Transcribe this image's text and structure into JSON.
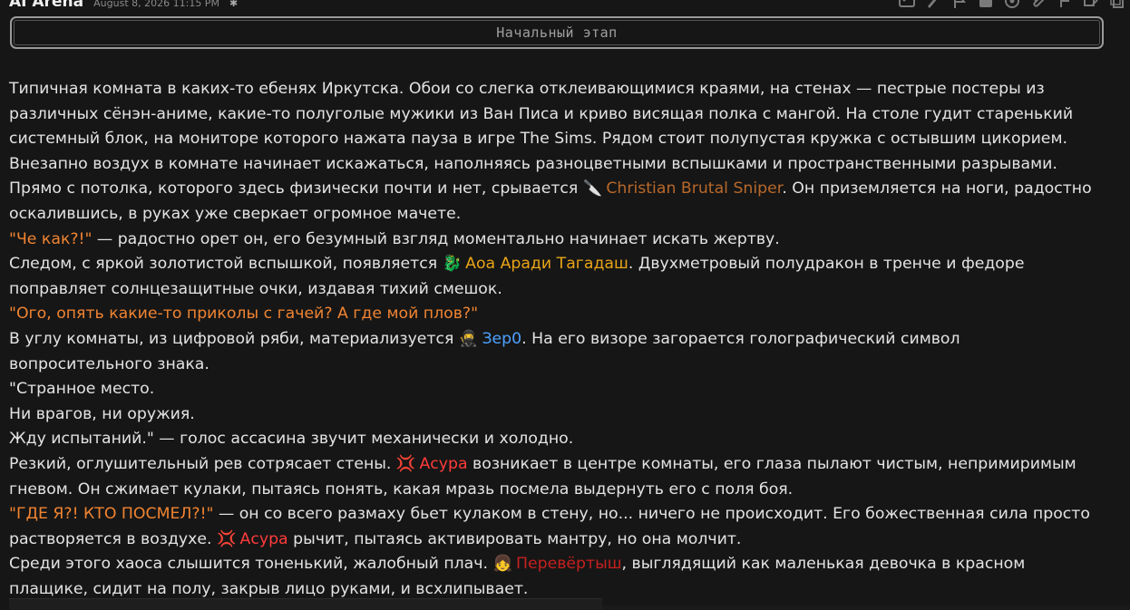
{
  "header": {
    "author": "AI Arena",
    "timestamp": "August 8, 2026 11:15 PM",
    "mark": "✱"
  },
  "toolbar": {
    "icons": [
      "image-icon",
      "brush-icon",
      "flag-icon",
      "card-icon",
      "globe-icon",
      "paperclip-icon",
      "branch-icon",
      "edit-icon",
      "copy-icon"
    ]
  },
  "stage": {
    "title": "Начальный этап"
  },
  "colors": {
    "background": "#161616",
    "text": "#e3e3e3",
    "quote": "#f08432",
    "sniper": "#b8682a",
    "aoa": "#e8a417",
    "zero": "#4ea1ff",
    "asura": "#ff3b3b",
    "perevertysh": "#c62020"
  },
  "story": {
    "l1": "Типичная комната в каких-то ебенях Иркутска. Обои со слегка отклеивающимися краями, на стенах — пестрые постеры из",
    "l2": "различных сёнэн-аниме, какие-то полуголые мужики из Ван Писа и криво висящая полка с мангой. На столе гудит старенький",
    "l3": "системный блок, на мониторе которого нажата пауза в игре The Sims. Рядом стоит полупустая кружка с остывшим цикорием.",
    "l4": "Внезапно воздух в комнате начинает искажаться, наполняясь разноцветными вспышками и пространственными разрывами.",
    "l5a": "Прямо с потолка, которого здесь физически почти и нет, срывается ",
    "l5_emoji": "🔪",
    "l5_name": "Christian Brutal Sniper",
    "l5b": ". Он приземляется на ноги, радостно",
    "l6": "оскалившись, в руках уже сверкает огромное мачете.",
    "l7_quote": "\"Че как?!\"",
    "l7b": " — радостно орет он, его безумный взгляд моментально начинает искать жертву.",
    "l8a": "Следом, с яркой золотистой вспышкой, появляется ",
    "l8_emoji": "🐉",
    "l8_name": "Аоа Аради Тагадаш",
    "l8b": ". Двухметровый полудракон в тренче и федоре",
    "l9": "поправляет солнцезащитные очки, издавая тихий смешок.",
    "l10_quote": "\"Ого, опять какие-то приколы с гачей? А где мой плов?\"",
    "l11a": "В углу комнаты, из цифровой ряби, материализуется ",
    "l11_emoji": "🥷",
    "l11_name": "Зер0",
    "l11b": ". На его визоре загорается голографический символ",
    "l12": "вопросительного знака.",
    "l13": "\"Странное место.",
    "l14": "Ни врагов, ни оружия.",
    "l15": "Жду испытаний.\" — голос ассасина звучит механически и холодно.",
    "l16a": "Резкий, оглушительный рев сотрясает стены. ",
    "l16_emoji": "💢",
    "l16_name": "Асура",
    "l16b": " возникает в центре комнаты, его глаза пылают чистым, непримиримым",
    "l17": "гневом. Он сжимает кулаки, пытаясь понять, какая мразь посмела выдернуть его с поля боя.",
    "l18_quote": "\"ГДЕ Я?! КТО ПОСМЕЛ?!\"",
    "l18b": " — он со всего размаху бьет кулаком в стену, но... ничего не происходит. Его божественная сила просто",
    "l19a": "растворяется в воздухе. ",
    "l19_emoji": "💢",
    "l19_name": "Асура",
    "l19b": " рычит, пытаясь активировать мантру, но она молчит.",
    "l20a": "Среди этого хаоса слышится тоненький, жалобный плач. ",
    "l20_emoji": "👧",
    "l20_name": "Перевёртыш",
    "l20b": ", выглядящий как маленькая девочка в красном",
    "l21": "плащике, сидит на полу, закрыв лицо руками, и всхлипывает."
  }
}
